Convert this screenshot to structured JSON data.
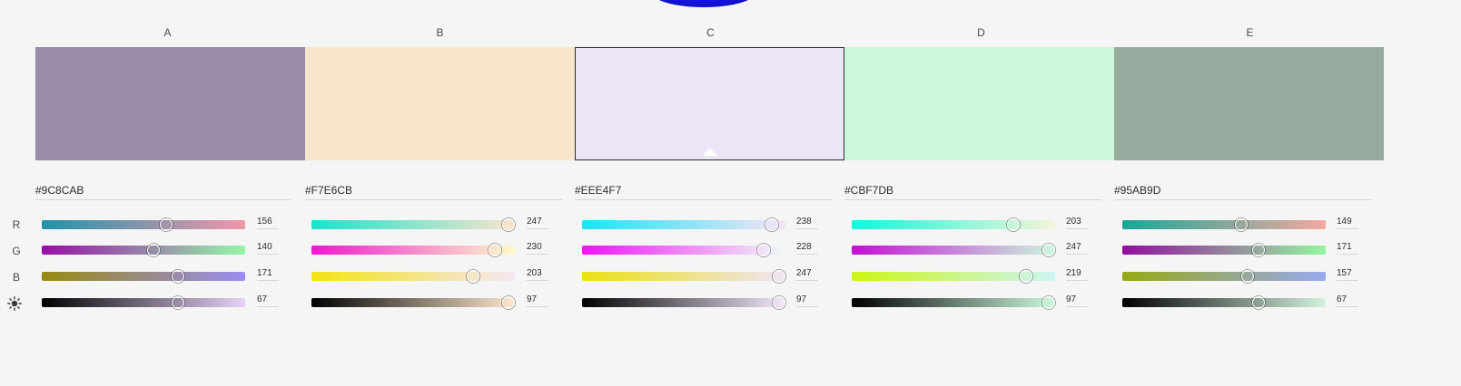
{
  "rows": [
    "R",
    "G",
    "B"
  ],
  "brightness_icon": "brightness-sun-icon",
  "columns": [
    {
      "label": "A",
      "hex": "#9C8CAB",
      "color": "#9C8CAB",
      "selected": false,
      "values": [
        156,
        140,
        171,
        67
      ],
      "gradients": [
        [
          "#1f93a9",
          "#f296ab"
        ],
        [
          "#970ea6",
          "#96f7a9"
        ],
        [
          "#978a10",
          "#9a8cf2"
        ],
        [
          "#000000",
          "#e6d2f7"
        ]
      ]
    },
    {
      "label": "B",
      "hex": "#F7E6CB",
      "color": "#F7E6CB",
      "selected": false,
      "values": [
        247,
        230,
        203,
        97
      ],
      "gradients": [
        [
          "#1ae3cc",
          "#fbe4cb"
        ],
        [
          "#f117cf",
          "#fcfcca"
        ],
        [
          "#f3e313",
          "#f5e6f5"
        ],
        [
          "#000000",
          "#fde8ce"
        ]
      ]
    },
    {
      "label": "C",
      "hex": "#EEE4F7",
      "color": "#EEE4F7",
      "selected": true,
      "values": [
        238,
        228,
        247,
        97
      ],
      "gradients": [
        [
          "#18e5f5",
          "#f6e4f7"
        ],
        [
          "#ee12f5",
          "#effbf7"
        ],
        [
          "#ece012",
          "#efe4f5"
        ],
        [
          "#000000",
          "#f3e8fb"
        ]
      ]
    },
    {
      "label": "D",
      "hex": "#CBF7DB",
      "color": "#CBF7DB",
      "selected": false,
      "values": [
        203,
        247,
        219,
        97
      ],
      "gradients": [
        [
          "#10f7dc",
          "#f5f5d8"
        ],
        [
          "#c30fd3",
          "#ccf8de"
        ],
        [
          "#ccf514",
          "#ccf5f5"
        ],
        [
          "#000000",
          "#cef9de"
        ]
      ]
    },
    {
      "label": "E",
      "hex": "#95AB9D",
      "color": "#95AB9D",
      "selected": false,
      "values": [
        149,
        171,
        157,
        67
      ],
      "gradients": [
        [
          "#16a898",
          "#f4a99e"
        ],
        [
          "#920f9d",
          "#96f7a0"
        ],
        [
          "#96a913",
          "#98a9f2"
        ],
        [
          "#000000",
          "#d5f2de"
        ]
      ]
    }
  ]
}
